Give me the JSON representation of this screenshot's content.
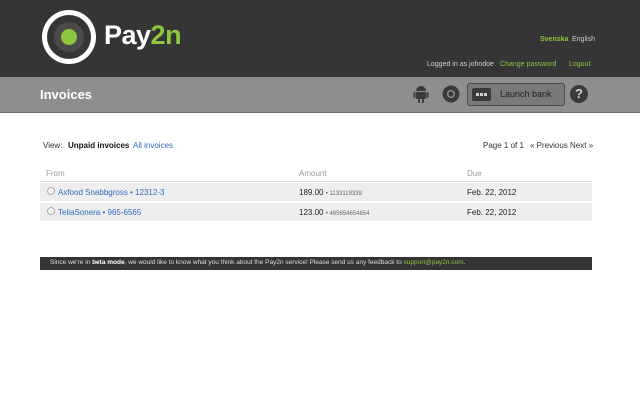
{
  "header": {
    "logo_text_main": "Pay",
    "logo_text_accent": "2n",
    "lang_svenska": "Svenska",
    "lang_english": "English",
    "logged_in": "Logged in as johndoe",
    "change_password": "Change password",
    "logout": "Logout"
  },
  "subbar": {
    "title": "Invoices",
    "launch_bank": "Launch bank",
    "help": "?"
  },
  "view": {
    "label": "View:",
    "unpaid": "Unpaid invoices",
    "all": "All invoices",
    "page_info": "Page 1 of 1",
    "prev_next": "« Previous Next »"
  },
  "table": {
    "columns": [
      "From",
      "Amount",
      "Due"
    ],
    "rows": [
      {
        "from": "Axfood Snabbgross  •  12312-3",
        "amount": "189.00",
        "ref": "•  1133119339",
        "due": "Feb. 22, 2012"
      },
      {
        "from": "TeliaSonera  •  965-6565",
        "amount": "123.00",
        "ref": "•  465654654654",
        "due": "Feb. 22, 2012"
      }
    ]
  },
  "beta": {
    "prefix": "Since we're in ",
    "mode": "beta mode",
    "middle": ", we would like to know what you think about the Pay2n service! Please send us any feedback to ",
    "email": "support@pay2n.com",
    "suffix": "."
  },
  "colors": {
    "brand_green": "#8dc63f",
    "topbar": "#353535",
    "link_blue": "#2f6cbf"
  }
}
